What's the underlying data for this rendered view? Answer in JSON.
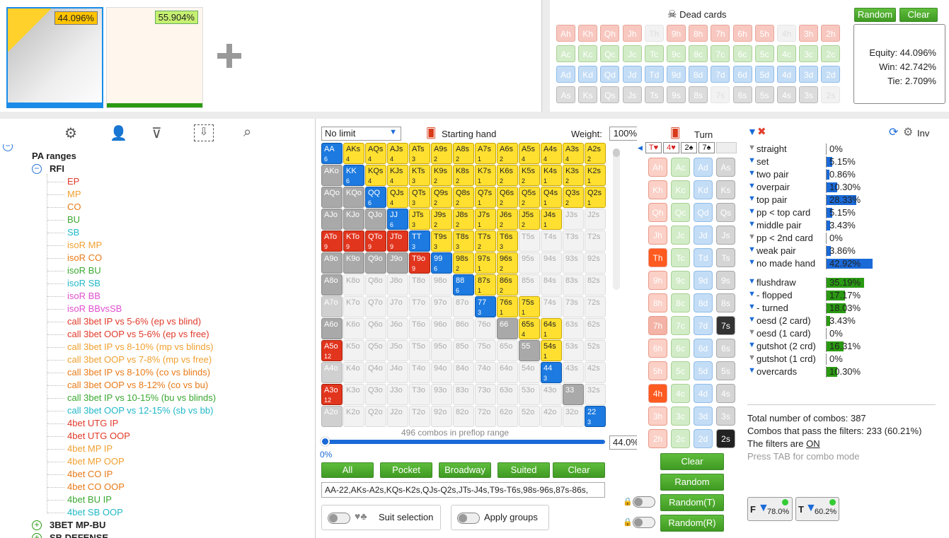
{
  "hands": {
    "h1_pct": "44.096%",
    "h2_pct": "55.904%"
  },
  "dead": {
    "title": "Dead cards",
    "random": "Random",
    "clear": "Clear",
    "rows": [
      [
        "Ah",
        "Kh",
        "Qh",
        "Jh",
        "Th",
        "9h",
        "8h",
        "7h",
        "6h",
        "5h",
        "4h",
        "3h",
        "2h"
      ],
      [
        "Ac",
        "Kc",
        "Qc",
        "Jc",
        "Tc",
        "9c",
        "8c",
        "7c",
        "6c",
        "5c",
        "4c",
        "3c",
        "2c"
      ],
      [
        "Ad",
        "Kd",
        "Qd",
        "Jd",
        "Td",
        "9d",
        "8d",
        "7d",
        "6d",
        "5d",
        "4d",
        "3d",
        "2d"
      ],
      [
        "As",
        "Ks",
        "Qs",
        "Js",
        "Ts",
        "9s",
        "8s",
        "7s",
        "6s",
        "5s",
        "4s",
        "3s",
        "2s"
      ]
    ],
    "equity": "Equity: 44.096%",
    "win": "Win: 42.742%",
    "tie": "Tie: 2.709%"
  },
  "tree": {
    "root": "PA ranges",
    "rfi": "RFI",
    "items": [
      {
        "t": "EP",
        "c": "#e03a2a"
      },
      {
        "t": "MP",
        "c": "#f0a030"
      },
      {
        "t": "CO",
        "c": "#e87a18"
      },
      {
        "t": "BU",
        "c": "#3aa830"
      },
      {
        "t": "SB",
        "c": "#20b8c8"
      },
      {
        "t": "isoR MP",
        "c": "#f0a030"
      },
      {
        "t": "isoR CO",
        "c": "#e87a18"
      },
      {
        "t": "isoR BU",
        "c": "#3aa830"
      },
      {
        "t": "isoR SB",
        "c": "#20b8c8"
      },
      {
        "t": "isoR BB",
        "c": "#e050d0"
      },
      {
        "t": "isoR BBvsSB",
        "c": "#e050d0"
      },
      {
        "t": "call 3bet IP vs 5-6% (ep vs blind)",
        "c": "#e03a2a"
      },
      {
        "t": "call 3bet OOP vs 5-6% (ep vs free)",
        "c": "#e03a2a"
      },
      {
        "t": "call 3bet IP vs 8-10% (mp vs blinds)",
        "c": "#f0a030"
      },
      {
        "t": "call 3bet OOP vs 7-8% (mp vs free)",
        "c": "#f0a030"
      },
      {
        "t": "call 3bet IP vs 8-10% (co vs blinds)",
        "c": "#e87a18"
      },
      {
        "t": "call 3bet OOP vs 8-12% (co vs bu)",
        "c": "#e87a18"
      },
      {
        "t": "call 3bet IP vs 10-15% (bu vs blinds)",
        "c": "#3aa830"
      },
      {
        "t": "call 3bet OOP vs 12-15% (sb vs bb)",
        "c": "#20b8c8"
      },
      {
        "t": "4bet UTG IP",
        "c": "#e03a2a"
      },
      {
        "t": "4bet UTG OOP",
        "c": "#e03a2a"
      },
      {
        "t": "4bet MP IP",
        "c": "#f0a030"
      },
      {
        "t": "4bet MP OOP",
        "c": "#f0a030"
      },
      {
        "t": "4bet CO IP",
        "c": "#e87a18"
      },
      {
        "t": "4bet CO OOP",
        "c": "#e87a18"
      },
      {
        "t": "4bet BU IP",
        "c": "#3aa830"
      },
      {
        "t": "4bet SB OOP",
        "c": "#20b8c8"
      }
    ],
    "g2": "3BET MP-BU",
    "g3": "SB DEFENSE"
  },
  "range": {
    "limit": "No limit",
    "starting": "Starting hand",
    "weight_label": "Weight:",
    "weight": "100%",
    "combos": "496 combos in preflop range",
    "slider_left": "0%",
    "slider_val": "44.0%",
    "btn_all": "All",
    "btn_pocket": "Pocket",
    "btn_broadway": "Broadway",
    "btn_suited": "Suited",
    "btn_clear": "Clear",
    "text": "AA-22,AKs-A2s,KQs-K2s,QJs-Q2s,JTs-J4s,T9s-T6s,98s-96s,87s-86s,",
    "suit_sel": "Suit selection",
    "apply_groups": "Apply groups"
  },
  "turn": {
    "title": "Turn",
    "board": [
      "T♥",
      "4♥",
      "2♠",
      "7♠"
    ],
    "clear": "Clear",
    "random": "Random",
    "random_t": "Random(T)",
    "random_r": "Random(R)"
  },
  "filters": {
    "inv": "Inv",
    "made": [
      {
        "l": "straight",
        "v": "0%",
        "f": 0
      },
      {
        "l": "set",
        "v": "5.15%",
        "f": 0.05
      },
      {
        "l": "two pair",
        "v": "0.86%",
        "f": 0.01
      },
      {
        "l": "overpair",
        "v": "10.30%",
        "f": 0.1
      },
      {
        "l": "top pair",
        "v": "28.33%",
        "f": 0.28
      },
      {
        "l": "pp < top card",
        "v": "5.15%",
        "f": 0.05
      },
      {
        "l": "middle pair",
        "v": "3.43%",
        "f": 0.03
      },
      {
        "l": "pp < 2nd card",
        "v": "0%",
        "f": 0
      },
      {
        "l": "weak pair",
        "v": "3.86%",
        "f": 0.04
      },
      {
        "l": "no made hand",
        "v": "42.92%",
        "f": 0.43
      }
    ],
    "draws": [
      {
        "l": "flushdraw",
        "v": "35.19%",
        "f": 0.35
      },
      {
        "l": "- flopped",
        "v": "17.17%",
        "f": 0.17
      },
      {
        "l": "- turned",
        "v": "18.03%",
        "f": 0.18
      },
      {
        "l": "oesd (2 card)",
        "v": "3.43%",
        "f": 0.03
      },
      {
        "l": "oesd (1 card)",
        "v": "0%",
        "f": 0
      },
      {
        "l": "gutshot (2 crd)",
        "v": "16.31%",
        "f": 0.16
      },
      {
        "l": "gutshot (1 crd)",
        "v": "0%",
        "f": 0
      },
      {
        "l": "overcards",
        "v": "10.30%",
        "f": 0.1
      }
    ],
    "total": "Total number of combos: 387",
    "pass": "Combos that pass the filters: 233 (60.21%)",
    "on_pre": "The filters are ",
    "on": "ON",
    "tab": "Press TAB for combo mode",
    "f_pct": "78.0%",
    "t_pct": "60.2%",
    "f_lbl": "F",
    "t_lbl": "T"
  }
}
